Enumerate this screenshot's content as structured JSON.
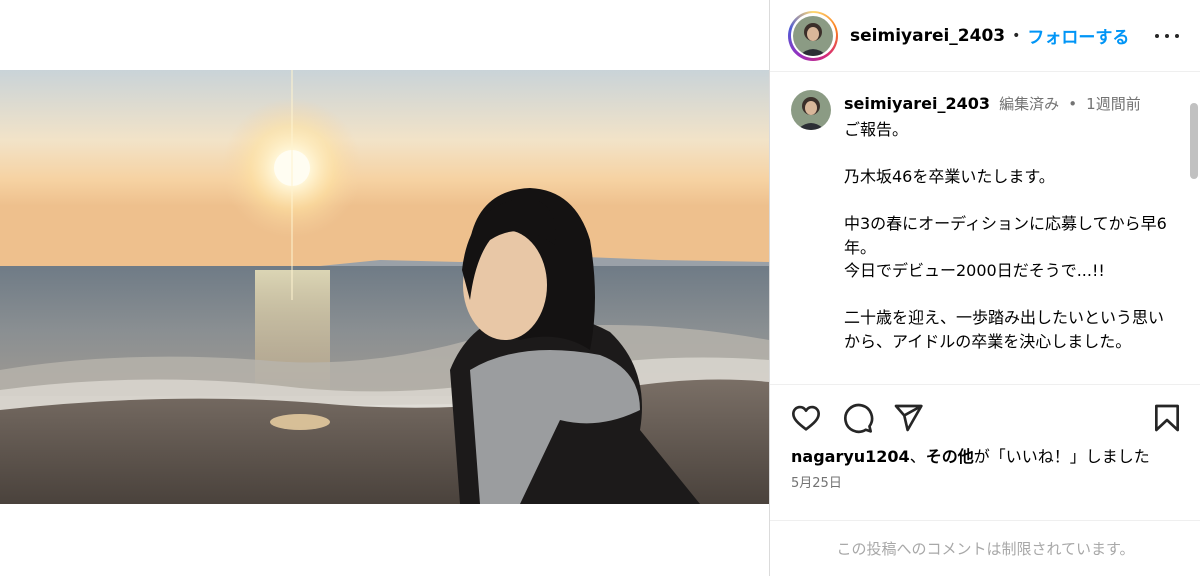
{
  "post": {
    "image_alt": "sunset beach photo",
    "username": "seimiyarei_2403",
    "header_separator": "•",
    "follow_label": "フォローする",
    "caption": {
      "username": "seimiyarei_2403",
      "edited": "編集済み",
      "separator": "•",
      "time": "1週間前",
      "text": "ご報告。\n\n乃木坂46を卒業いたします。\n\n中3の春にオーディションに応募してから早6年。\n今日でデビュー2000日だそうで...!!\n\n二十歳を迎え、一歩踏み出したいという思いから、アイドルの卒業を決心しました。"
    },
    "likes": {
      "user": "nagaryu1204",
      "middle": "、",
      "others": "その他",
      "suffix": "が「いいね！」しました"
    },
    "date": "5月25日",
    "comments_disabled": "この投稿へのコメントは制限されています。"
  },
  "icons": {
    "more": "more-icon",
    "like": "heart-icon",
    "comment": "comment-icon",
    "share": "send-icon",
    "save": "bookmark-icon"
  },
  "colors": {
    "follow": "#0095f6",
    "muted": "#737373",
    "disabled": "#a8a8a8",
    "border": "#dbdbdb"
  }
}
